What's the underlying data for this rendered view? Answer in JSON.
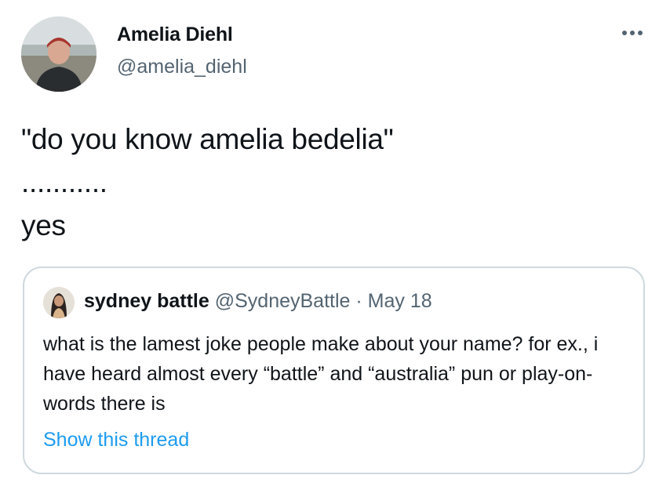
{
  "author": {
    "display_name": "Amelia Diehl",
    "handle": "@amelia_diehl",
    "avatar_icon": "profile-photo"
  },
  "menu": {
    "icon": "more-horizontal-icon"
  },
  "tweet": {
    "text": "\"do you know amelia bedelia\"\n...........\nyes"
  },
  "quoted_tweet": {
    "display_name": "sydney battle",
    "handle": "@SydneyBattle",
    "separator": "·",
    "date": "May 18",
    "text": "what is the lamest joke people make about your name? for ex., i have heard almost every “battle” and “australia” pun or play-on-words there is",
    "show_thread_label": "Show this thread"
  },
  "colors": {
    "text_primary": "#0f1419",
    "text_secondary": "#536471",
    "link": "#1d9bf0",
    "border": "#cfd9de"
  }
}
